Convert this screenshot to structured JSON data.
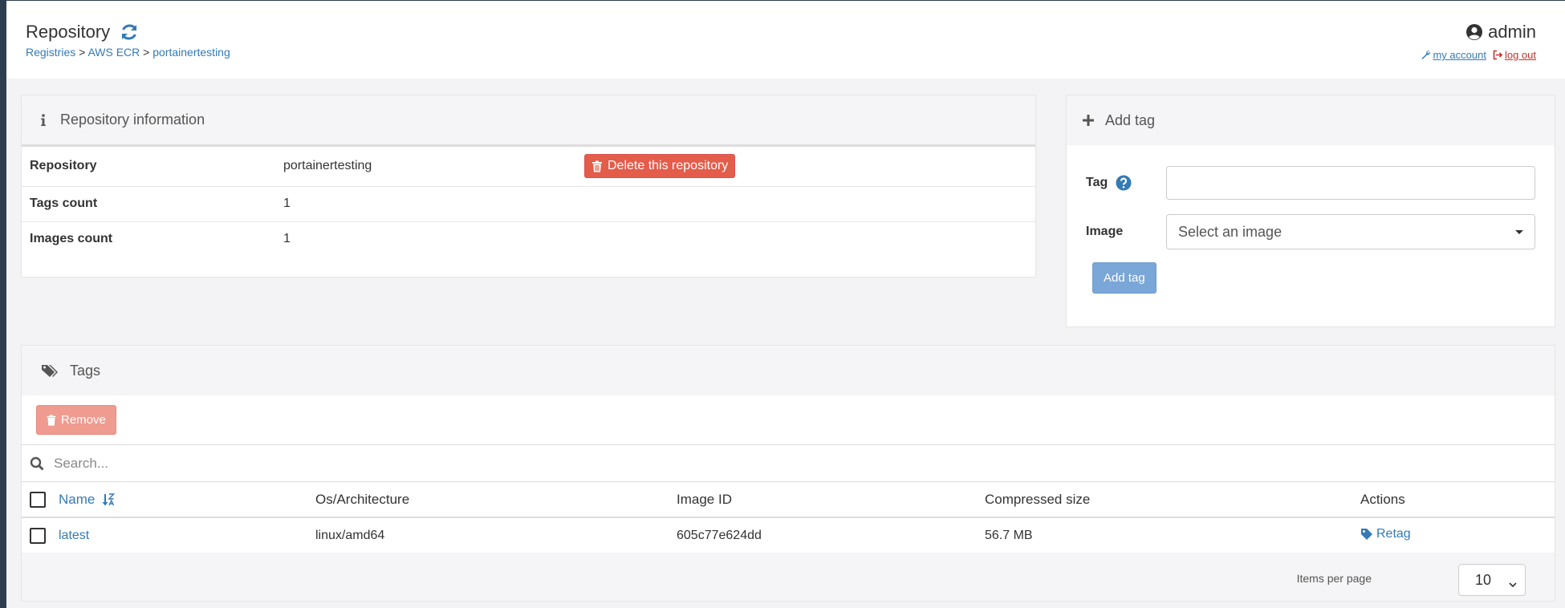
{
  "header": {
    "title": "Repository",
    "breadcrumb": {
      "registries": "Registries",
      "sep1": ">",
      "registry": "AWS ECR",
      "sep2": ">",
      "repository": "portainertesting"
    },
    "user": {
      "name": "admin",
      "my_account": "my account",
      "log_out": "log out"
    }
  },
  "repository_info": {
    "title": "Repository information",
    "rows": [
      {
        "label": "Repository",
        "value": "portainertesting"
      },
      {
        "label": "Tags count",
        "value": "1"
      },
      {
        "label": "Images count",
        "value": "1"
      }
    ],
    "delete_button": "Delete this repository"
  },
  "add_tag": {
    "title": "Add tag",
    "tag_label": "Tag",
    "tag_value": "",
    "image_label": "Image",
    "image_placeholder": "Select an image",
    "submit_button": "Add tag"
  },
  "tags": {
    "title": "Tags",
    "remove_button": "Remove",
    "search_placeholder": "Search...",
    "columns": [
      "Name",
      "Os/Architecture",
      "Image ID",
      "Compressed size",
      "Actions"
    ],
    "rows": [
      {
        "name": "latest",
        "os_arch": "linux/amd64",
        "image_id": "605c77e624dd",
        "size": "56.7 MB",
        "action": "Retag"
      }
    ],
    "items_per_page_label": "Items per page",
    "items_per_page_value": "10"
  },
  "colors": {
    "primary": "#337ab7",
    "danger": "#e35d4a",
    "danger_disabled": "#f09b90",
    "primary_disabled": "#7aa6d8",
    "logout": "#c9302c"
  }
}
